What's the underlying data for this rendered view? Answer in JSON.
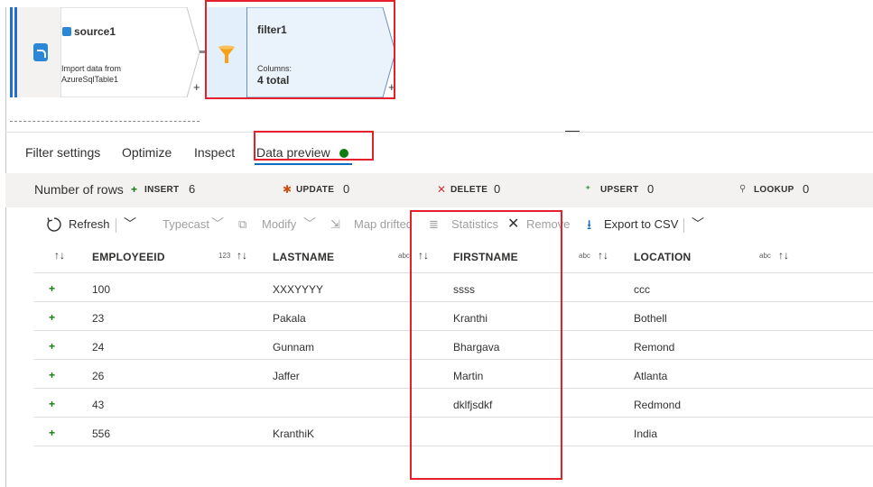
{
  "pipeline": {
    "source": {
      "title": "source1",
      "subtitle_line1": "Import data from",
      "subtitle_line2": "AzureSqlTable1",
      "add": "+"
    },
    "filter": {
      "title": "filter1",
      "columns_label": "Columns:",
      "columns_value": "4 total",
      "add": "+"
    }
  },
  "tabs": [
    {
      "label": "Filter settings"
    },
    {
      "label": "Optimize"
    },
    {
      "label": "Inspect"
    },
    {
      "label": "Data preview",
      "active": true
    }
  ],
  "counts": {
    "title": "Number of rows",
    "items": [
      {
        "icon": "plus-icon",
        "label": "INSERT",
        "value": "6",
        "color": "#107c10"
      },
      {
        "icon": "asterisk-icon",
        "label": "UPDATE",
        "value": "0",
        "color": "#ca5010"
      },
      {
        "icon": "x-icon",
        "label": "DELETE",
        "value": "0",
        "color": "#d13438"
      },
      {
        "icon": "upsert-icon",
        "label": "UPSERT",
        "value": "0",
        "color": "#107c10"
      },
      {
        "icon": "search-icon",
        "label": "LOOKUP",
        "value": "0",
        "color": "#605e5c"
      }
    ]
  },
  "toolbar": {
    "refresh": "Refresh",
    "typecast": "Typecast",
    "modify": "Modify",
    "map_drifted": "Map drifted",
    "statistics": "Statistics",
    "remove": "Remove",
    "export": "Export to CSV"
  },
  "table": {
    "columns": [
      {
        "name": "EMPLOYEEID",
        "type": "123"
      },
      {
        "name": "LASTNAME",
        "type": "abc"
      },
      {
        "name": "FIRSTNAME",
        "type": "abc"
      },
      {
        "name": "LOCATION",
        "type": "abc"
      }
    ],
    "rows": [
      {
        "marker": "+",
        "cells": [
          "100",
          "XXXYYYY",
          "ssss",
          "ccc"
        ]
      },
      {
        "marker": "+",
        "cells": [
          "23",
          "Pakala",
          "Kranthi",
          "Bothell"
        ]
      },
      {
        "marker": "+",
        "cells": [
          "24",
          "Gunnam",
          "Bhargava",
          "Remond"
        ]
      },
      {
        "marker": "+",
        "cells": [
          "26",
          "Jaffer",
          "Martin",
          "Atlanta"
        ]
      },
      {
        "marker": "+",
        "cells": [
          "43",
          "",
          "dklfjsdkf",
          "Redmond"
        ]
      },
      {
        "marker": "+",
        "cells": [
          "556",
          "KranthiK",
          "",
          "India"
        ]
      }
    ]
  },
  "colors": {
    "accent": "#0f6cbd",
    "highlight": "#e4202a",
    "status_ok": "#107c10"
  }
}
